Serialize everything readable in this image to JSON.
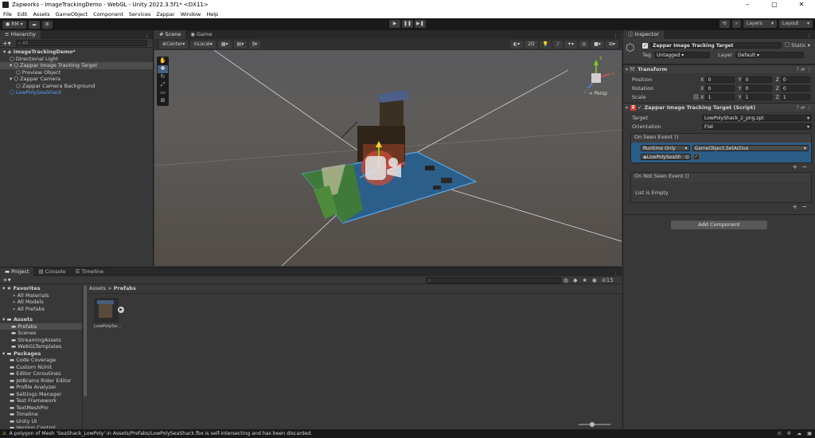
{
  "window": {
    "title": "Zapworks - ImageTrackingDemo - WebGL - Unity 2022.3.5f1* <DX11>"
  },
  "menu": [
    "File",
    "Edit",
    "Assets",
    "GameObject",
    "Component",
    "Services",
    "Zappar",
    "Window",
    "Help"
  ],
  "toolbar": {
    "account": "RM",
    "layers_label": "Layers",
    "layout_label": "Layout"
  },
  "hierarchy": {
    "tab": "Hierarchy",
    "search_placeholder": "All",
    "items": [
      {
        "label": "ImageTrackingDemo*",
        "depth": 0,
        "state": "scene"
      },
      {
        "label": "Directional Light",
        "depth": 1,
        "state": "normal"
      },
      {
        "label": "Zappar Image Tracking Target",
        "depth": 1,
        "state": "highlighted"
      },
      {
        "label": "Preview Object",
        "depth": 2,
        "state": "normal"
      },
      {
        "label": "Zappar Camera",
        "depth": 1,
        "state": "normal"
      },
      {
        "label": "Zappar Camera Background",
        "depth": 2,
        "state": "normal"
      },
      {
        "label": "LowPolySeaShack",
        "depth": 1,
        "state": "blue"
      }
    ]
  },
  "scene": {
    "tabs": [
      "Scene",
      "Game"
    ],
    "pivot_mode": "Center",
    "pivot_rotation": "Local",
    "gizmo_label": "Persp",
    "axes": {
      "x": "x",
      "y": "y",
      "z": "z"
    }
  },
  "inspector": {
    "tab": "Inspector",
    "object_name": "Zappar Image Tracking Target",
    "static_label": "Static",
    "tag_label": "Tag",
    "tag_value": "Untagged",
    "layer_label": "Layer",
    "layer_value": "Default",
    "transform": {
      "title": "Transform",
      "position_label": "Position",
      "rotation_label": "Rotation",
      "scale_label": "Scale",
      "position": {
        "x": "0",
        "y": "0",
        "z": "0"
      },
      "rotation": {
        "x": "0",
        "y": "0",
        "z": "0"
      },
      "scale": {
        "x": "1",
        "y": "1",
        "z": "1"
      }
    },
    "script": {
      "title": "Zappar Image Tracking Target (Script)",
      "target_label": "Target",
      "target_value": "LowPolyShack_2_png.zpt",
      "orientation_label": "Orientation",
      "orientation_value": "Flat",
      "on_seen_label": "On Seen Event ()",
      "runtime_value": "Runtime Only",
      "function_value": "GameObject.SetActive",
      "object_value": "LowPolySeaSh",
      "on_not_seen_label": "On Not Seen Event ()",
      "list_empty": "List is Empty"
    },
    "add_component": "Add Component"
  },
  "project": {
    "tabs": [
      "Project",
      "Console",
      "Timeline"
    ],
    "breadcrumb": [
      "Assets",
      "Prefabs"
    ],
    "hidden_count": "15",
    "favorites": {
      "label": "Favorites",
      "items": [
        "All Materials",
        "All Models",
        "All Prefabs"
      ]
    },
    "assets": {
      "label": "Assets",
      "items": [
        "Prefabs",
        "Scenes",
        "StreamingAssets",
        "WebGLTemplates"
      ]
    },
    "packages": {
      "label": "Packages",
      "items": [
        "Code Coverage",
        "Custom NUnit",
        "Editor Coroutines",
        "JetBrains Rider Editor",
        "Profile Analyzer",
        "Settings Manager",
        "Test Framework",
        "TextMeshPro",
        "Timeline",
        "Unity UI",
        "Version Control"
      ]
    },
    "asset_item": "LowPolySe..."
  },
  "status": {
    "message": "A polygon of Mesh 'SeaShack_LowPoly' in Assets/Prefabs/LowPolySeaShack.fbx is self-intersecting and has been discarded."
  },
  "colors": {
    "selection": "#2c5d87",
    "blue_text": "#5a9bff",
    "warning": "#f2c94c"
  }
}
